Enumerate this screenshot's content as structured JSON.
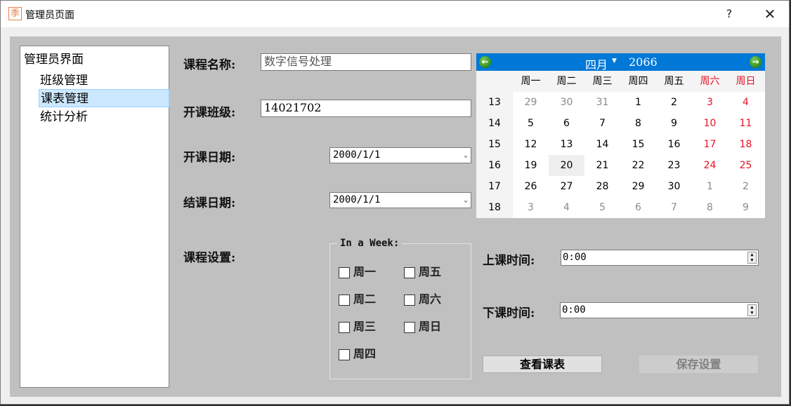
{
  "window": {
    "title": "管理员页面",
    "app_icon_glyph": "季",
    "help_label": "?",
    "close_label": "✕"
  },
  "tree": {
    "root": "管理员界面",
    "items": [
      {
        "label": "班级管理",
        "selected": false
      },
      {
        "label": "课表管理",
        "selected": true
      },
      {
        "label": "统计分析",
        "selected": false
      }
    ]
  },
  "form": {
    "course_name_label": "课程名称:",
    "course_name_value": "数字信号处理",
    "class_label": "开课班级:",
    "class_value": "14021702",
    "start_date_label": "开课日期:",
    "start_date_value": "2000/1/1",
    "end_date_label": "结课日期:",
    "end_date_value": "2000/1/1",
    "settings_label": "课程设置:",
    "start_time_label": "上课时间:",
    "start_time_value": "0:00",
    "end_time_label": "下课时间:",
    "end_time_value": "0:00"
  },
  "week_group": {
    "title": "In a Week:",
    "days": [
      {
        "label": "周一",
        "checked": false
      },
      {
        "label": "周二",
        "checked": false
      },
      {
        "label": "周三",
        "checked": false
      },
      {
        "label": "周四",
        "checked": false
      },
      {
        "label": "周五",
        "checked": false
      },
      {
        "label": "周六",
        "checked": false
      },
      {
        "label": "周日",
        "checked": false
      }
    ]
  },
  "calendar": {
    "month": "四月",
    "year": "2066",
    "prev_icon": "arrow-left",
    "next_icon": "arrow-right",
    "weekdays": [
      "周一",
      "周二",
      "周三",
      "周四",
      "周五",
      "周六",
      "周日"
    ],
    "week_numbers": [
      "13",
      "14",
      "15",
      "16",
      "17",
      "18"
    ],
    "today": "20",
    "weeks": [
      [
        "29",
        "30",
        "31",
        "1",
        "2",
        "3",
        "4"
      ],
      [
        "5",
        "6",
        "7",
        "8",
        "9",
        "10",
        "11"
      ],
      [
        "12",
        "13",
        "14",
        "15",
        "16",
        "17",
        "18"
      ],
      [
        "19",
        "20",
        "21",
        "22",
        "23",
        "24",
        "25"
      ],
      [
        "26",
        "27",
        "28",
        "29",
        "30",
        "1",
        "2"
      ],
      [
        "3",
        "4",
        "5",
        "6",
        "7",
        "8",
        "9"
      ]
    ],
    "colors": {
      "header": "#0078d7",
      "weekend": "#e81123",
      "dim": "#8a8a8a"
    }
  },
  "buttons": {
    "view_schedule": "查看课表",
    "save_settings": "保存设置",
    "save_enabled": false
  }
}
